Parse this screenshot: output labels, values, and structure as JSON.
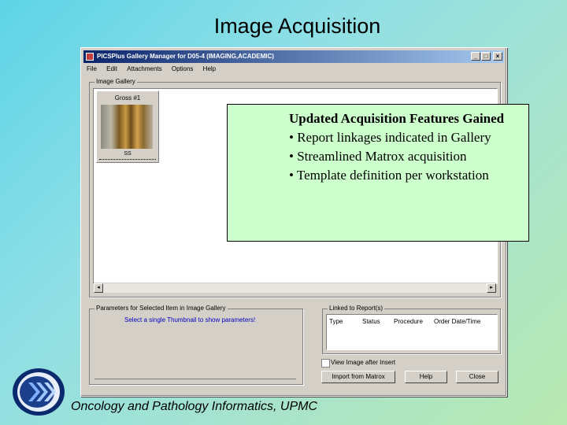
{
  "slide": {
    "title": "Image Acquisition",
    "footer": "Oncology and Pathology Informatics, UPMC"
  },
  "window": {
    "title": "PICSPlus Gallery Manager for D05-4 (IMAGING,ACADEMIC)",
    "caption_buttons": [
      "_",
      "□",
      "×"
    ],
    "menu": [
      "File",
      "Edit",
      "Attachments",
      "Options",
      "Help"
    ]
  },
  "gallery": {
    "group_label": "Image Gallery",
    "thumbnail": {
      "label": "Gross #1",
      "sublabel": "SS"
    }
  },
  "parameters": {
    "group_label": "Parameters for Selected Item in Image Gallery",
    "hint": "Select a single Thumbnail to show parameters!"
  },
  "linked": {
    "group_label": "Linked to Report(s)",
    "columns": [
      "Type",
      "Status",
      "Procedure",
      "Order Date/Time"
    ]
  },
  "checkbox_label": "View Image after Insert",
  "buttons": {
    "import": "Import from Matrox",
    "help": "Help",
    "close": "Close"
  },
  "callout": {
    "heading": "Updated Acquisition Features Gained",
    "items": [
      "• Report linkages indicated in Gallery",
      "• Streamlined Matrox acquisition",
      "• Template definition per workstation"
    ]
  },
  "colors": {
    "titlebar_start": "#0a246a",
    "callout_bg": "#ccffcc",
    "hint_text": "#0000c0"
  }
}
